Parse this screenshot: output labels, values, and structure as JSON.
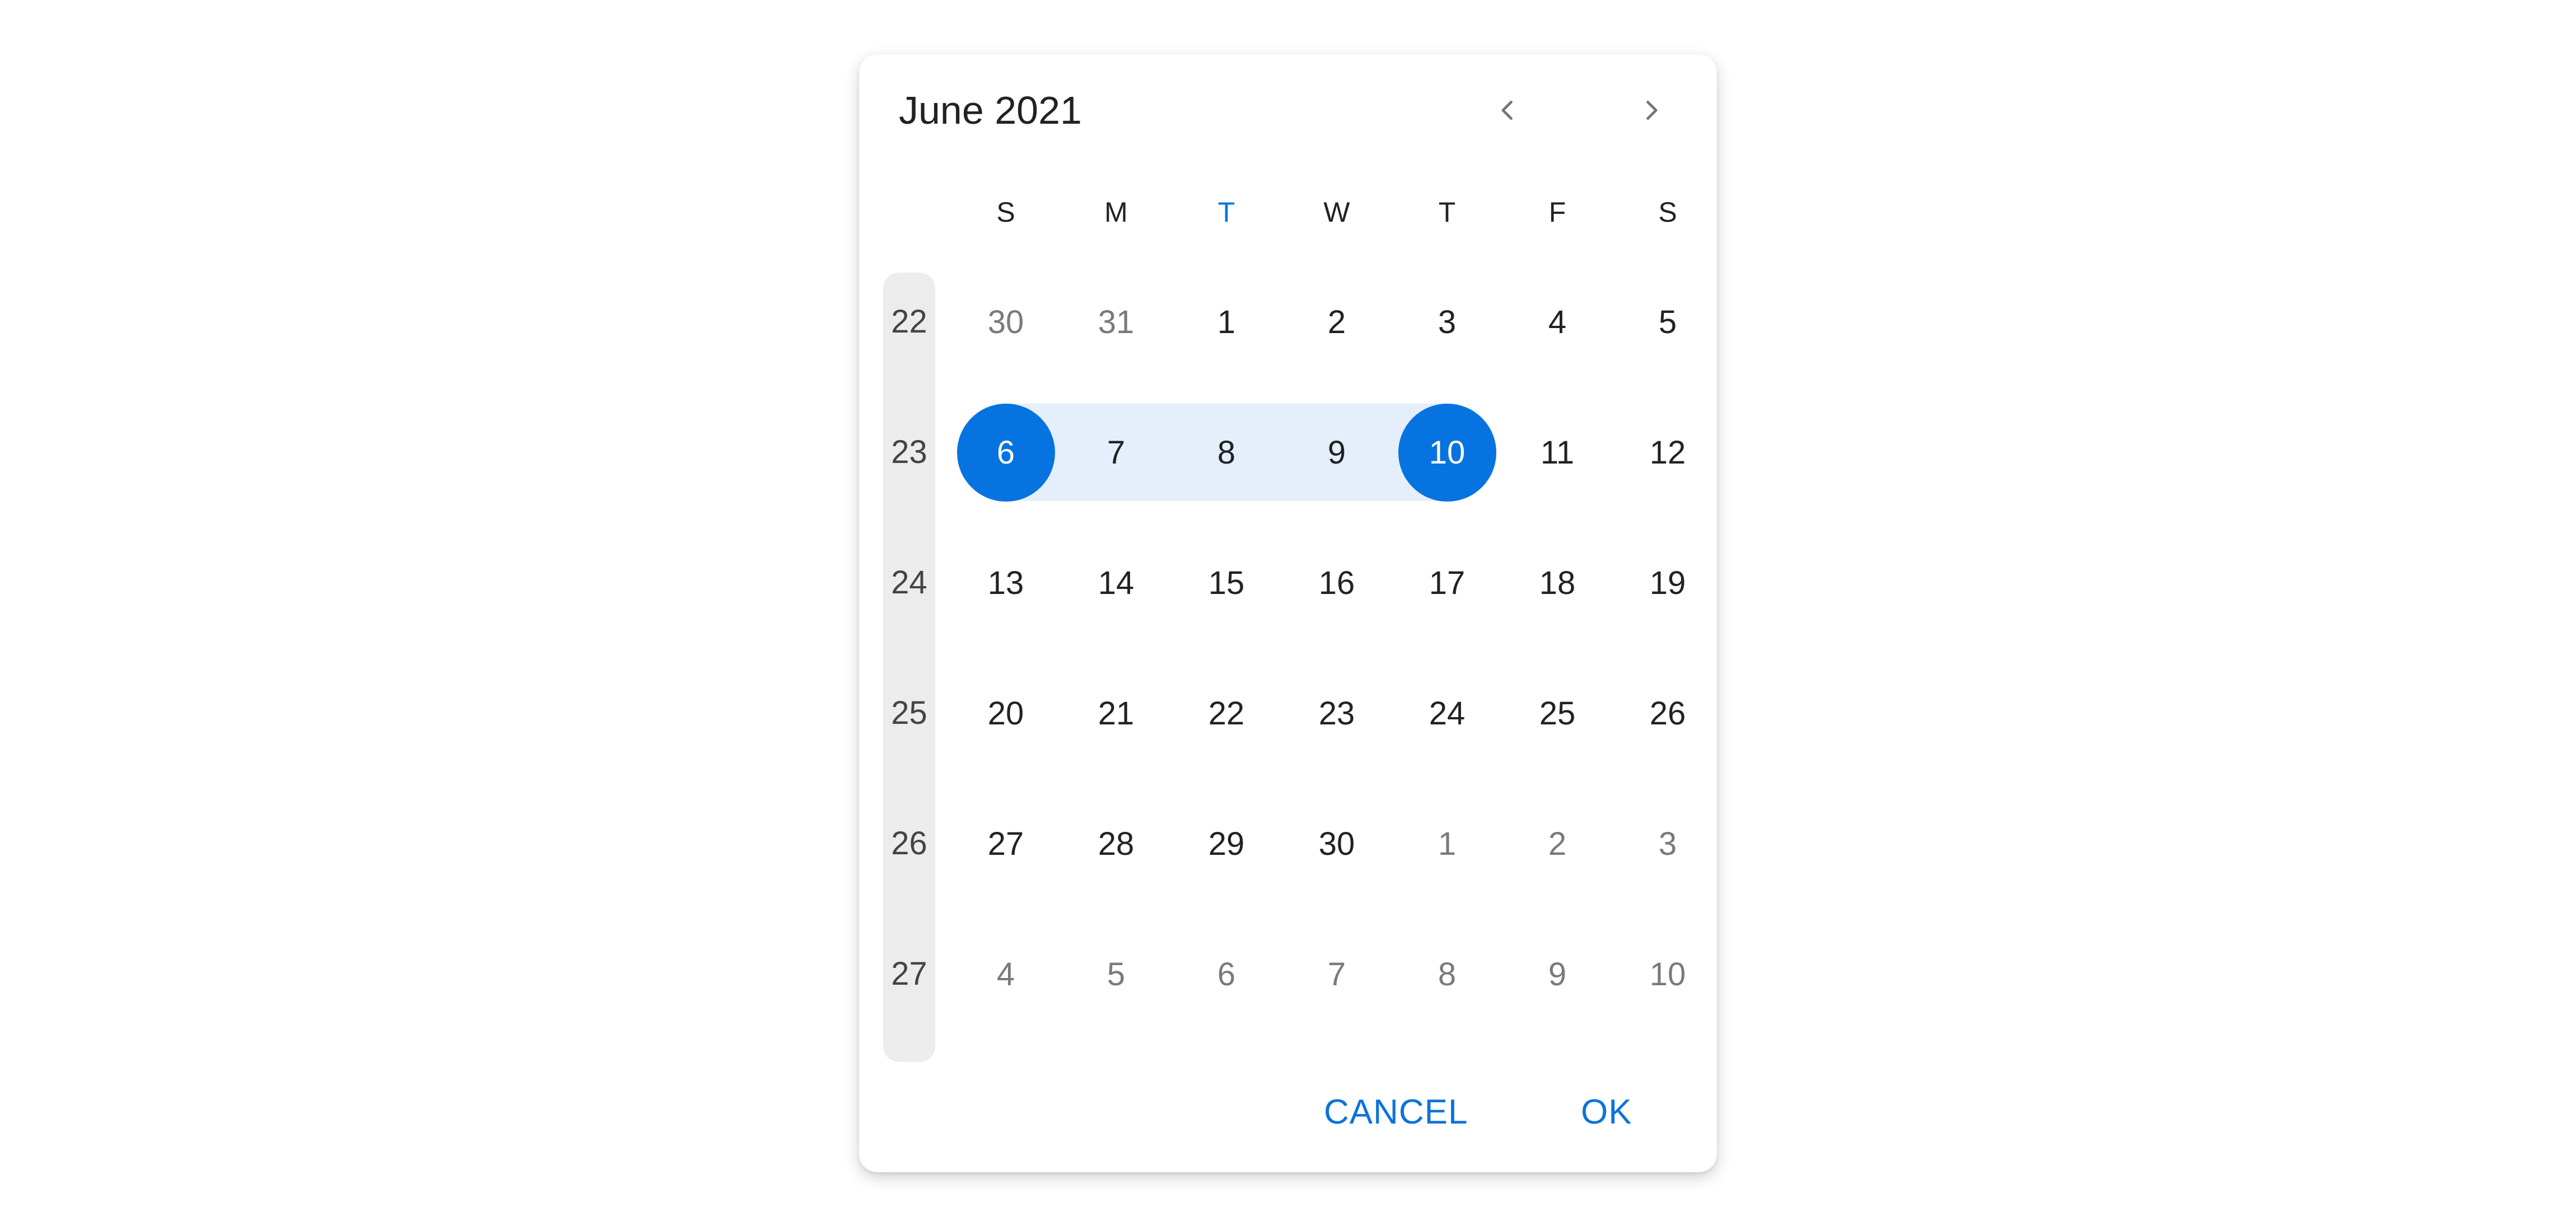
{
  "header": {
    "title": "June 2021",
    "prev_icon": "chevron-left-icon",
    "next_icon": "chevron-right-icon"
  },
  "weekdays": [
    {
      "label": "S",
      "today": false
    },
    {
      "label": "M",
      "today": false
    },
    {
      "label": "T",
      "today": true
    },
    {
      "label": "W",
      "today": false
    },
    {
      "label": "T",
      "today": false
    },
    {
      "label": "F",
      "today": false
    },
    {
      "label": "S",
      "today": false
    }
  ],
  "weeks": [
    {
      "week": "22",
      "days": [
        {
          "d": "30",
          "other": true
        },
        {
          "d": "31",
          "other": true
        },
        {
          "d": "1"
        },
        {
          "d": "2"
        },
        {
          "d": "3"
        },
        {
          "d": "4"
        },
        {
          "d": "5"
        }
      ]
    },
    {
      "week": "23",
      "days": [
        {
          "d": "6",
          "selected": true
        },
        {
          "d": "7",
          "inRange": true
        },
        {
          "d": "8",
          "inRange": true
        },
        {
          "d": "9",
          "inRange": true
        },
        {
          "d": "10",
          "selected": true
        },
        {
          "d": "11"
        },
        {
          "d": "12"
        }
      ]
    },
    {
      "week": "24",
      "days": [
        {
          "d": "13"
        },
        {
          "d": "14"
        },
        {
          "d": "15"
        },
        {
          "d": "16"
        },
        {
          "d": "17"
        },
        {
          "d": "18"
        },
        {
          "d": "19"
        }
      ]
    },
    {
      "week": "25",
      "days": [
        {
          "d": "20"
        },
        {
          "d": "21"
        },
        {
          "d": "22"
        },
        {
          "d": "23"
        },
        {
          "d": "24"
        },
        {
          "d": "25"
        },
        {
          "d": "26"
        }
      ]
    },
    {
      "week": "26",
      "days": [
        {
          "d": "27"
        },
        {
          "d": "28"
        },
        {
          "d": "29"
        },
        {
          "d": "30"
        },
        {
          "d": "1",
          "other": true
        },
        {
          "d": "2",
          "other": true
        },
        {
          "d": "3",
          "other": true
        }
      ]
    },
    {
      "week": "27",
      "days": [
        {
          "d": "4",
          "other": true
        },
        {
          "d": "5",
          "other": true
        },
        {
          "d": "6",
          "other": true
        },
        {
          "d": "7",
          "other": true
        },
        {
          "d": "8",
          "other": true
        },
        {
          "d": "9",
          "other": true
        },
        {
          "d": "10",
          "other": true
        }
      ]
    }
  ],
  "selection": {
    "start": "6",
    "end": "10",
    "month": "June 2021"
  },
  "footer": {
    "cancel_label": "CANCEL",
    "ok_label": "OK"
  },
  "colors": {
    "accent": "#0773e0",
    "range_band": "#e4effb",
    "week_column": "#ececec",
    "other_month_text": "#7a7a7a"
  }
}
